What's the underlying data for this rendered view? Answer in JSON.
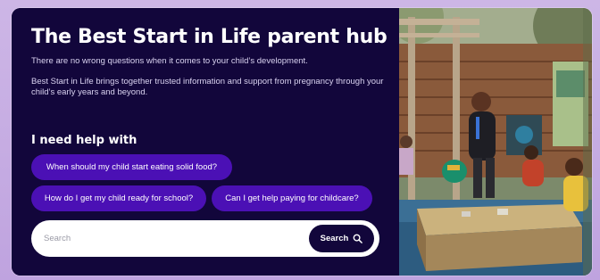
{
  "hub": {
    "title": "The Best Start in Life parent hub",
    "intro": "There are no wrong questions when it comes to your child’s development.",
    "description": "Best Start in Life brings together trusted information and support from pregnancy through your child’s early years and beyond."
  },
  "help": {
    "heading": "I need help with",
    "chips": [
      "When should my child start eating solid food?",
      "How do I get my child ready for school?",
      "Can I get help paying for childcare?"
    ]
  },
  "search": {
    "placeholder": "Search",
    "button_label": "Search",
    "button_icon": "magnifier-icon"
  },
  "photo": {
    "alt_subject": "photo-nursery-sandpit"
  },
  "colors": {
    "panel": "#12063b",
    "chip": "#4b10b5",
    "page_bg": "#cdb6e6"
  }
}
